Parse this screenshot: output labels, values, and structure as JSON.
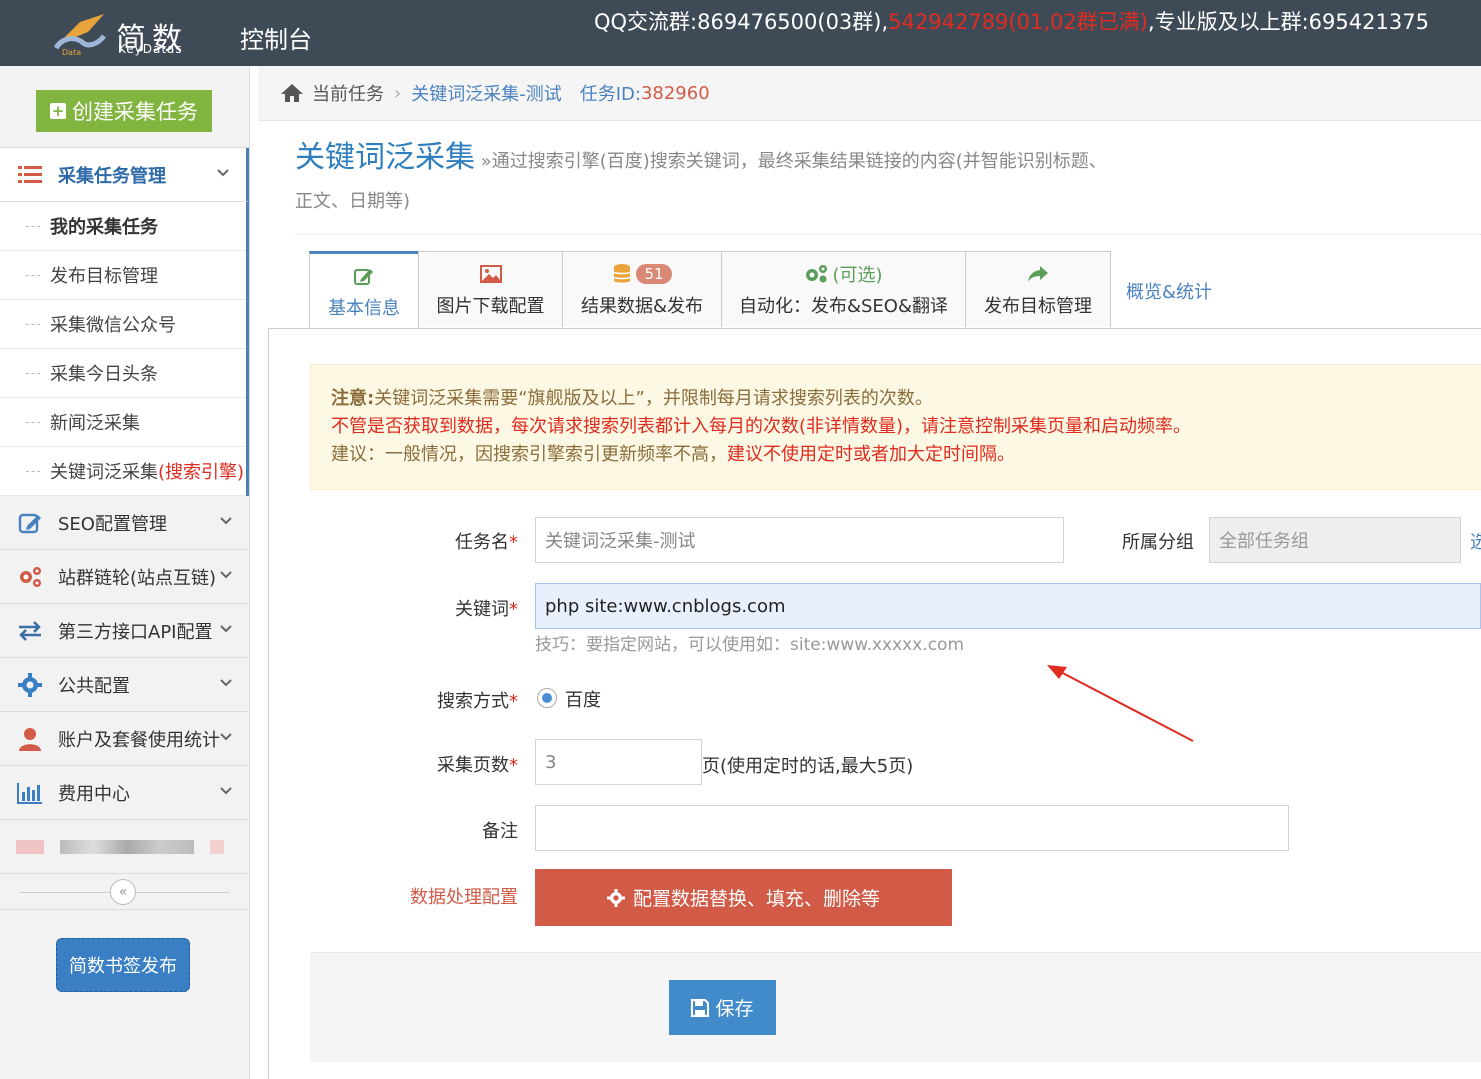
{
  "header": {
    "logo_cn": "简数",
    "logo_en": "KeyDatas",
    "console": "控制台",
    "qq_prefix": "QQ交流群:869476500(03群),",
    "qq_full": "542942789(01,02群已满)",
    "qq_suffix": ",专业版及以上群:695421375"
  },
  "sidebar": {
    "create_label": "创建采集任务",
    "task_mgmt": "采集任务管理",
    "sub_items": [
      "我的采集任务",
      "发布目标管理",
      "采集微信公众号",
      "采集今日头条",
      "新闻泛采集"
    ],
    "keyword_item": "关键词泛采集",
    "keyword_item_red": "(搜索引擎)",
    "menus": [
      "SEO配置管理",
      "站群链轮(站点互链)",
      "第三方接口API配置",
      "公共配置",
      "账户及套餐使用统计",
      "费用中心"
    ],
    "bookmark_btn": "简数书签发布"
  },
  "breadcrumb": {
    "home": "当前任务",
    "current": "关键词泛采集-测试",
    "task_id_label": "任务ID:",
    "task_id": "382960"
  },
  "page": {
    "title": "关键词泛采集",
    "desc": "»通过搜索引擎(百度)搜索关键词，最终采集结果链接的内容(并智能识别标题、",
    "desc2": "正文、日期等)"
  },
  "tabs": {
    "basic": "基本信息",
    "images": "图片下载配置",
    "results": "结果数据&发布",
    "results_badge": "51",
    "auto_opt": "(可选)",
    "auto": "自动化：发布&SEO&翻译",
    "publish_target": "发布目标管理",
    "overview": "概览&统计"
  },
  "notice": {
    "line1_label": "注意:",
    "line1": "关键词泛采集需要“旗舰版及以上”，并限制每月请求搜索列表的次数。",
    "line2": "不管是否获取到数据，每次请求搜索列表都计入每月的次数(非详情数量)，请注意控制采集页量和启动频率。",
    "line3_prefix": "建议：一般情况，因搜索引擎索引更新频率不高，",
    "line3_red": "建议不使用定时或者加大定时间隔。"
  },
  "form": {
    "task_name_label": "任务名",
    "task_name_value": "关键词泛采集-测试",
    "group_label": "所属分组",
    "group_value": "全部任务组",
    "group_more": "选",
    "keyword_label": "关键词",
    "keyword_value": "php site:www.cnblogs.com",
    "keyword_hint": "技巧：要指定网站，可以使用如：site:www.xxxxx.com",
    "search_label": "搜索方式",
    "search_option": "百度",
    "pages_label": "采集页数",
    "pages_value": "3",
    "pages_suffix": "页(使用定时的话,最大5页)",
    "remark_label": "备注",
    "remark_value": "",
    "data_proc_label": "数据处理配置",
    "data_proc_btn": "配置数据替换、填充、删除等",
    "save": "保存",
    "required_mark": "*"
  },
  "colors": {
    "topbar": "#3f4a57",
    "accent": "#4a82c0",
    "danger": "#d15b47",
    "create_green": "#82b440",
    "save_blue": "#428bca"
  }
}
